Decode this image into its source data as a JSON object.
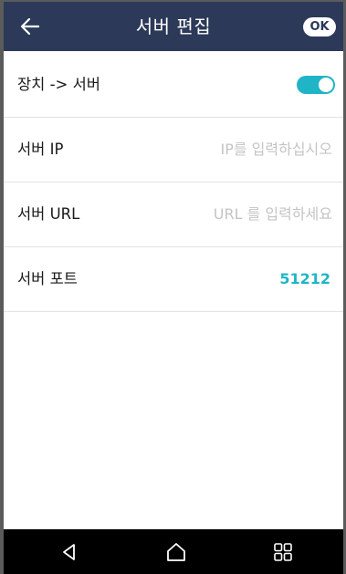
{
  "header": {
    "title": "서버 편집",
    "ok_label": "OK",
    "back_icon": "arrow-left-icon"
  },
  "rows": [
    {
      "label": "장치 -> 서버",
      "toggle_on": true
    },
    {
      "label": "서버 IP",
      "placeholder": "IP를 입력하십시오",
      "value": ""
    },
    {
      "label": "서버 URL",
      "placeholder": "URL 를 입력하세요",
      "value": ""
    },
    {
      "label": "서버 포트",
      "value": "51212"
    }
  ],
  "navbar": {
    "back_icon": "triangle-back-icon",
    "home_icon": "home-icon",
    "recents_icon": "grid-recents-icon"
  },
  "colors": {
    "header_bg": "#2c3958",
    "accent": "#1fb5c6",
    "placeholder": "#c4c4c4"
  }
}
